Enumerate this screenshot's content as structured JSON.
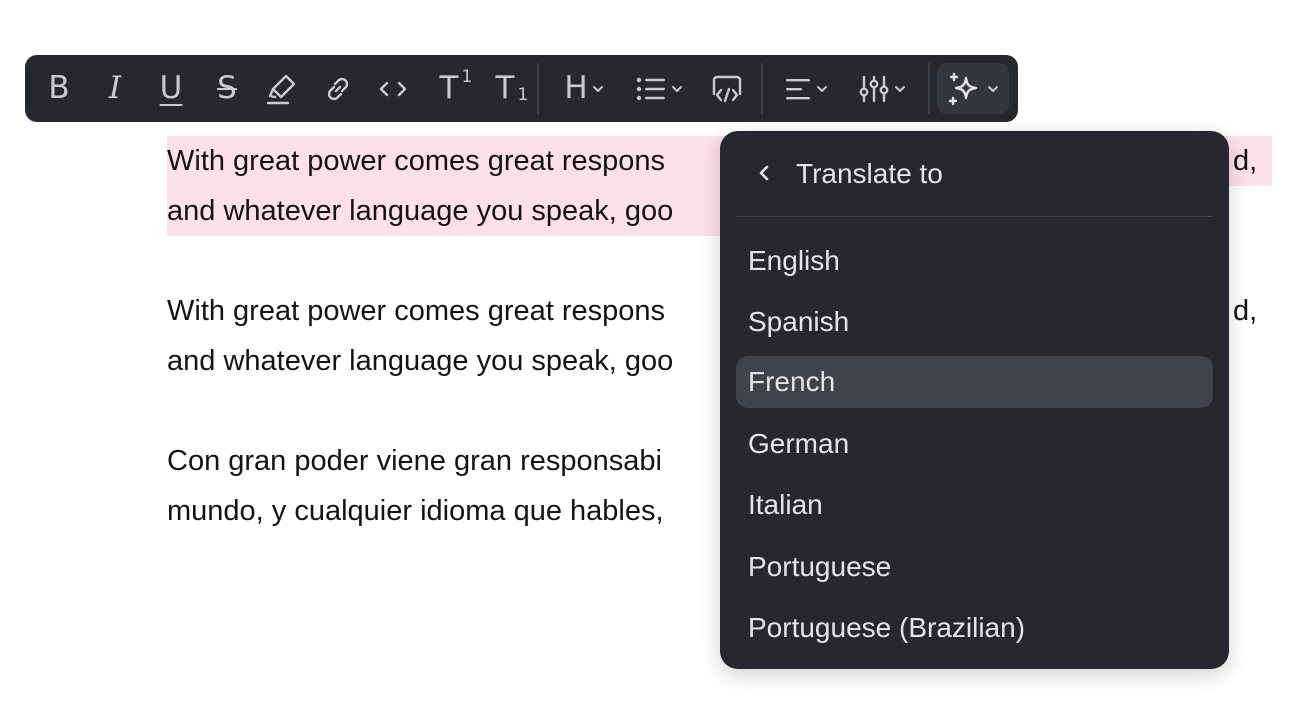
{
  "toolbar": {
    "buttons": [
      {
        "name": "bold",
        "label": "B"
      },
      {
        "name": "italic",
        "label": "I"
      },
      {
        "name": "underline",
        "label": "U"
      },
      {
        "name": "strikethrough",
        "label": "S"
      },
      {
        "name": "highlight"
      },
      {
        "name": "link"
      },
      {
        "name": "code"
      },
      {
        "name": "superscript",
        "label": "T",
        "sup": "1"
      },
      {
        "name": "subscript",
        "label": "T",
        "sub": "1"
      },
      {
        "name": "heading",
        "label": "H"
      },
      {
        "name": "list"
      },
      {
        "name": "code-block"
      },
      {
        "name": "align"
      },
      {
        "name": "adjust"
      },
      {
        "name": "ai"
      }
    ]
  },
  "content": {
    "paragraphs": [
      {
        "line1": "With great power comes great respons",
        "line1_end": "d,",
        "line2": "and whatever language you speak, goo",
        "highlighted": true
      },
      {
        "line1": "With great power comes great respons",
        "line1_end": "d,",
        "line2": "and whatever language you speak, goo",
        "highlighted": false
      },
      {
        "line1": "Con gran poder viene gran responsabi",
        "line1_end": "",
        "line2": "mundo, y cualquier idioma que hables,",
        "highlighted": false
      }
    ]
  },
  "translate_menu": {
    "title": "Translate to",
    "items": [
      {
        "label": "English",
        "active": false
      },
      {
        "label": "Spanish",
        "active": false
      },
      {
        "label": "French",
        "active": true
      },
      {
        "label": "German",
        "active": false
      },
      {
        "label": "Italian",
        "active": false
      },
      {
        "label": "Portuguese",
        "active": false
      },
      {
        "label": "Portuguese (Brazilian)",
        "active": false
      }
    ]
  },
  "colors": {
    "toolbar_bg": "#26282d",
    "menu_bg": "#26282d",
    "menu_active": "#404349",
    "highlight": "#fde0ea",
    "icon": "#c9cbd0"
  }
}
